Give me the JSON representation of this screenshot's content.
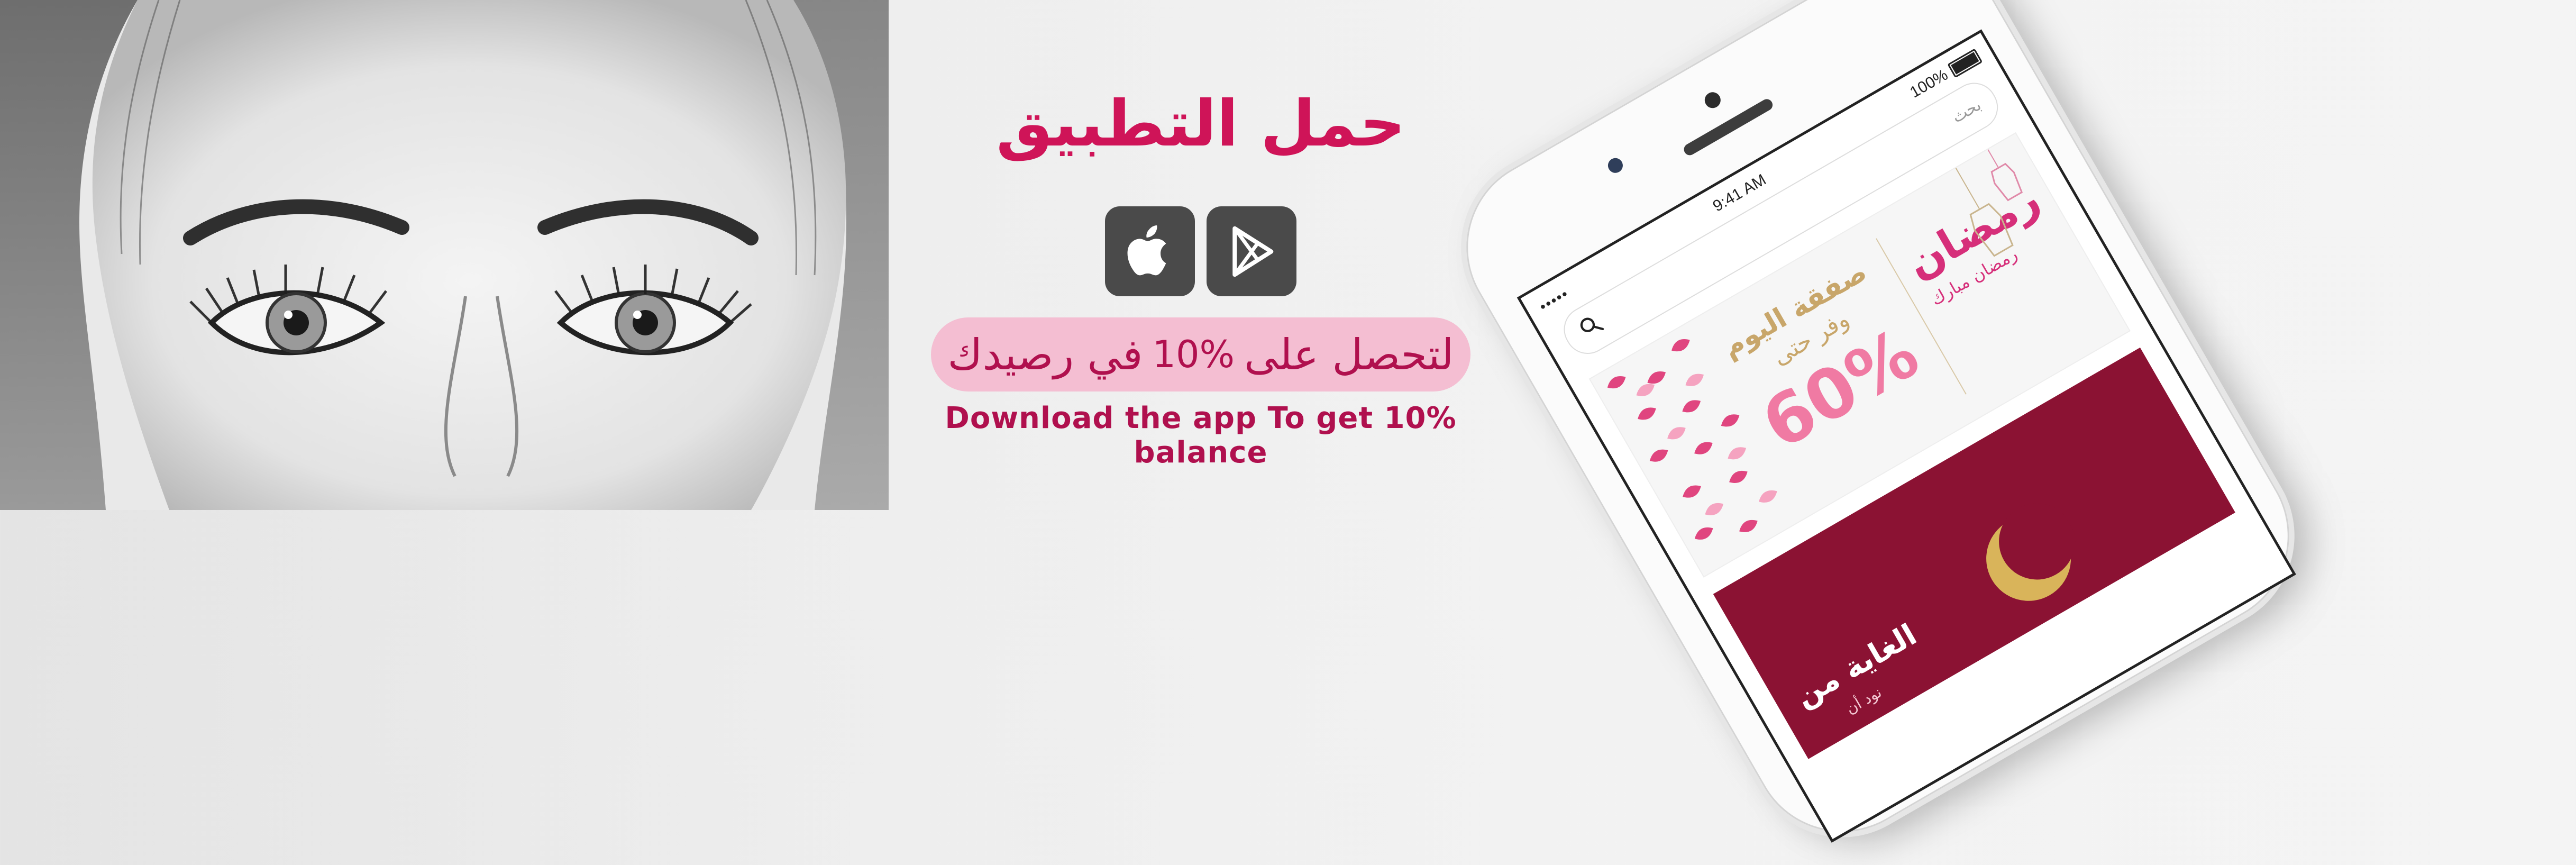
{
  "hero": {
    "title": "حمل التطبيق",
    "promo_prefix": "لتحصل على",
    "promo_percent": "10%",
    "promo_suffix": "في رصيدك",
    "subtitle": "Download the app  To get 10% balance"
  },
  "stores": [
    {
      "name": "apple-app-store",
      "icon": "apple-logo-icon"
    },
    {
      "name": "google-play",
      "icon": "play-store-icon"
    }
  ],
  "phone": {
    "status": {
      "time": "9:41 AM",
      "battery": "100%",
      "signal": "•••••"
    },
    "search_placeholder": "بحث",
    "deal": {
      "title": "صفقة اليوم",
      "subtitle": "وفر حتى",
      "percent": "60%",
      "ramadan_logo": "رمضان",
      "ramadan_text": "رمضان مبارك"
    },
    "promo2": {
      "title": "الغاية من",
      "note": "نود أن"
    }
  },
  "colors": {
    "brand": "#cf1458",
    "pill_bg": "#f4bed2",
    "store_button": "#4a4a4a",
    "deal_gold": "#c8a66a",
    "deal_pink": "#f07aa3",
    "promo_maroon": "#8b1233"
  }
}
